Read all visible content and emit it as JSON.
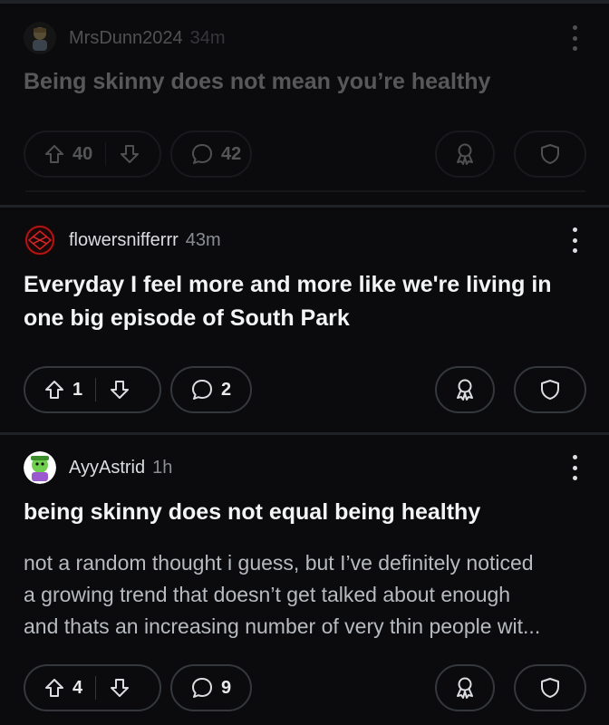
{
  "posts": [
    {
      "username": "MrsDunn2024",
      "age": "34m",
      "title": "Being skinny does not mean you’re healthy",
      "upvotes": "40",
      "comments": "42",
      "faded": true
    },
    {
      "username": "flowersnifferrr",
      "age": "43m",
      "title_line1": "Everyday I feel more and more like we're living in",
      "title_line2": "one big episode of South Park",
      "upvotes": "1",
      "comments": "2"
    },
    {
      "username": "AyyAstrid",
      "age": "1h",
      "title": "being skinny does not equal being healthy",
      "body_line1": "not a random thought i guess, but I’ve definitely noticed",
      "body_line2": "a growing trend that doesn’t get talked about enough",
      "body_line3": "and thats an increasing number of very thin people wit...",
      "upvotes": "4",
      "comments": "9"
    }
  ],
  "icons": {
    "upvote": "arrow-up-icon",
    "downvote": "arrow-down-icon",
    "comment": "comment-bubble-icon",
    "award": "award-icon",
    "share": "shield-share-icon",
    "more": "more-vertical-icon"
  }
}
